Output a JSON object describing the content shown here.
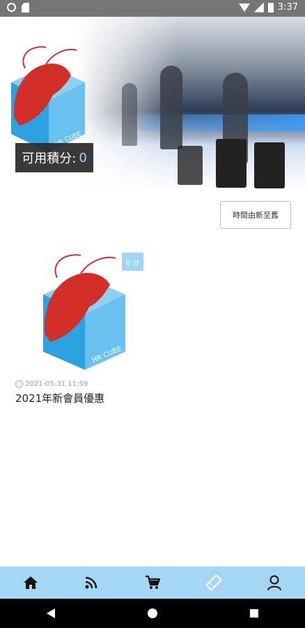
{
  "status_bar": {
    "time": "3:37",
    "icons": [
      "notification-dot-icon",
      "sd-card-icon",
      "wifi-icon",
      "signal-icon",
      "battery-icon"
    ]
  },
  "hero": {
    "points_label": "可用積分:",
    "points_value": "0",
    "logo_text": "HR CUBE"
  },
  "sort_button": {
    "label": "時間由新至舊"
  },
  "coupons": [
    {
      "points": "0 分",
      "date": "2021-05-31 11:59",
      "title": "2021年新會員優惠",
      "logo_text": "HR CUBE"
    }
  ],
  "bottom_nav": {
    "items": [
      {
        "icon": "home-icon"
      },
      {
        "icon": "rss-feed-icon"
      },
      {
        "icon": "cart-icon"
      },
      {
        "icon": "ticket-icon",
        "active": true
      },
      {
        "icon": "user-icon"
      }
    ]
  },
  "system_nav": {
    "icons": [
      "back-icon",
      "home-circle-icon",
      "recents-icon"
    ]
  },
  "colors": {
    "accent": "#a4d7f3",
    "tag": "#9fd5f5",
    "status_bar": "#757575",
    "shrimp_red": "#d12f27",
    "cube_blue": "#2aa3e0"
  }
}
